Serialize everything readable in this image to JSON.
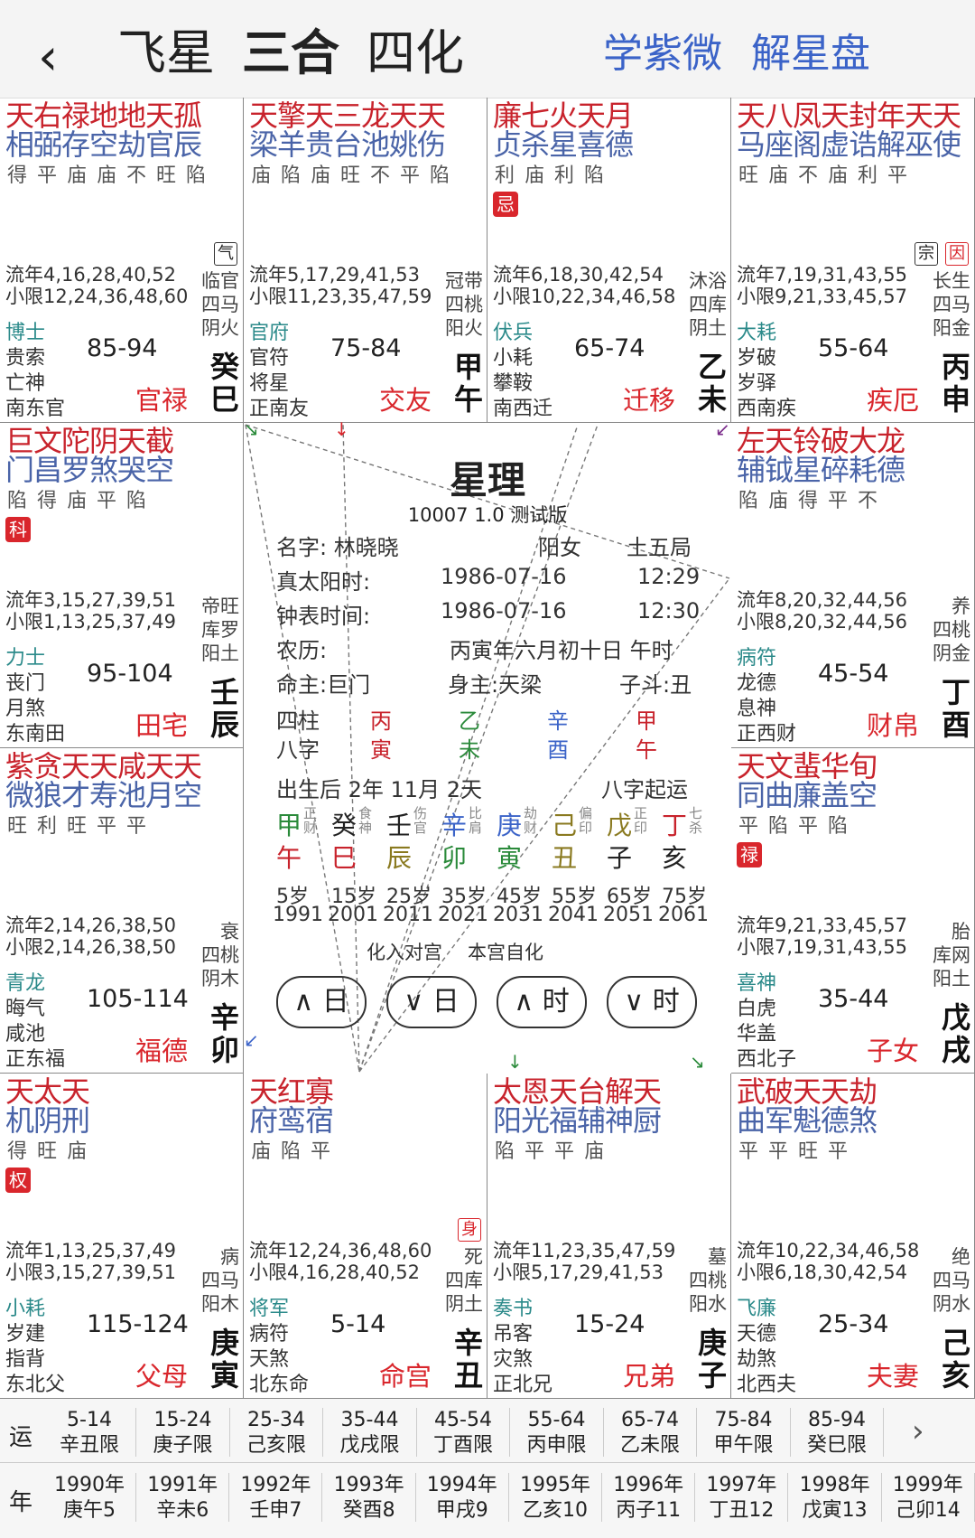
{
  "header": {
    "back": "‹",
    "tabs": [
      "飞星",
      "三合",
      "四化"
    ],
    "links": [
      "学紫微",
      "解星盘"
    ]
  },
  "cells": [
    {
      "stars": [
        {
          "t": "天右禄地地天孤",
          "c": "#c8232c"
        },
        {
          "t": "相弼存空劫官辰",
          "c": "#4a64a8"
        }
      ],
      "bright": "得 平 庙 庙 不 旺 陷",
      "hua": "",
      "tags": [
        {
          "t": "气",
          "red": false
        }
      ],
      "liunian": "流年4,16,28,40,52",
      "xiaoxian": "小限12,24,36,48,60",
      "boshi": "博士",
      "s2": "贵索",
      "s3": "亡神",
      "s4": "南东官",
      "range": "85-94",
      "pname": "官禄",
      "r1": "临官",
      "r2": "四马",
      "r3": "阴火",
      "g1": "癸",
      "g2": "巳"
    },
    {
      "stars": [
        {
          "t": "天擎天三龙天天",
          "c": "#c8232c"
        },
        {
          "t": "梁羊贵台池姚伤",
          "c": "#4a64a8"
        }
      ],
      "bright": "庙 陷 庙 旺 不 平 陷",
      "hua": "",
      "tags": [],
      "liunian": "流年5,17,29,41,53",
      "xiaoxian": "小限11,23,35,47,59",
      "boshi": "官府",
      "s2": "官符",
      "s3": "将星",
      "s4": "正南友",
      "range": "75-84",
      "pname": "交友",
      "r1": "冠带",
      "r2": "四桃",
      "r3": "阳火",
      "g1": "甲",
      "g2": "午"
    },
    {
      "stars": [
        {
          "t": "廉七火天月",
          "c": "#c8232c"
        },
        {
          "t": "贞杀星喜德",
          "c": "#4a64a8"
        }
      ],
      "bright": "利 庙 利 陷",
      "hua": "忌",
      "tags": [],
      "liunian": "流年6,18,30,42,54",
      "xiaoxian": "小限10,22,34,46,58",
      "boshi": "伏兵",
      "s2": "小耗",
      "s3": "攀鞍",
      "s4": "南西迁",
      "range": "65-74",
      "pname": "迁移",
      "r1": "沐浴",
      "r2": "四库",
      "r3": "阴土",
      "g1": "乙",
      "g2": "未"
    },
    {
      "stars": [
        {
          "t": "天八凤天封年天天",
          "c": "#c8232c"
        },
        {
          "t": "马座阁虚诰解巫使",
          "c": "#4a64a8"
        }
      ],
      "bright": "旺 庙 不 庙   利    平",
      "hua": "",
      "tags": [
        {
          "t": "宗",
          "red": false
        },
        {
          "t": "因",
          "red": true
        }
      ],
      "liunian": "流年7,19,31,43,55",
      "xiaoxian": "小限9,21,33,45,57",
      "boshi": "大耗",
      "s2": "岁破",
      "s3": "岁驿",
      "s4": "西南疾",
      "range": "55-64",
      "pname": "疾厄",
      "r1": "长生",
      "r2": "四马",
      "r3": "阳金",
      "g1": "丙",
      "g2": "申"
    },
    {
      "stars": [
        {
          "t": "巨文陀阴天截",
          "c": "#c8232c"
        },
        {
          "t": "门昌罗煞哭空",
          "c": "#4a64a8"
        }
      ],
      "bright": "陷 得 庙    平 陷",
      "hua": "科",
      "tags": [],
      "liunian": "流年3,15,27,39,51",
      "xiaoxian": "小限1,13,25,37,49",
      "boshi": "力士",
      "s2": "丧门",
      "s3": "月煞",
      "s4": "东南田",
      "range": "95-104",
      "pname": "田宅",
      "r1": "帝旺",
      "r2": "库罗",
      "r3": "阳土",
      "g1": "壬",
      "g2": "辰"
    },
    {
      "stars": [
        {
          "t": "左天铃破大龙",
          "c": "#c8232c"
        },
        {
          "t": "辅钺星碎耗德",
          "c": "#4a64a8"
        }
      ],
      "bright": "陷 庙 得 平 不",
      "hua": "",
      "tags": [],
      "liunian": "流年8,20,32,44,56",
      "xiaoxian": "小限8,20,32,44,56",
      "boshi": "病符",
      "s2": "龙德",
      "s3": "息神",
      "s4": "正西财",
      "range": "45-54",
      "pname": "财帛",
      "r1": "养",
      "r2": "四桃",
      "r3": "阴金",
      "g1": "丁",
      "g2": "酉"
    },
    {
      "stars": [
        {
          "t": "紫贪天天咸天天",
          "c": "#c8232c"
        },
        {
          "t": "微狼才寿池月空",
          "c": "#4a64a8"
        }
      ],
      "bright": "旺 利 旺    平    平",
      "hua": "",
      "tags": [],
      "liunian": "流年2,14,26,38,50",
      "xiaoxian": "小限2,14,26,38,50",
      "boshi": "青龙",
      "s2": "晦气",
      "s3": "咸池",
      "s4": "正东福",
      "range": "105-114",
      "pname": "福德",
      "r1": "衰",
      "r2": "四桃",
      "r3": "阴木",
      "g1": "辛",
      "g2": "卯"
    },
    {
      "stars": [
        {
          "t": "天文蜚华旬",
          "c": "#c8232c"
        },
        {
          "t": "同曲廉盖空",
          "c": "#4a64a8"
        }
      ],
      "bright": "平 陷    平 陷",
      "hua": "禄",
      "tags": [],
      "liunian": "流年9,21,33,45,57",
      "xiaoxian": "小限7,19,31,43,55",
      "boshi": "喜神",
      "s2": "白虎",
      "s3": "华盖",
      "s4": "西北子",
      "range": "35-44",
      "pname": "子女",
      "r1": "胎",
      "r2": "库网",
      "r3": "阳土",
      "g1": "戊",
      "g2": "戌"
    },
    {
      "stars": [
        {
          "t": "天太天",
          "c": "#c8232c"
        },
        {
          "t": "机阴刑",
          "c": "#4a64a8"
        }
      ],
      "bright": "得 旺 庙",
      "hua": "权",
      "tags": [],
      "liunian": "流年1,13,25,37,49",
      "xiaoxian": "小限3,15,27,39,51",
      "boshi": "小耗",
      "s2": "岁建",
      "s3": "指背",
      "s4": "东北父",
      "range": "115-124",
      "pname": "父母",
      "r1": "病",
      "r2": "四马",
      "r3": "阳木",
      "g1": "庚",
      "g2": "寅"
    },
    {
      "stars": [
        {
          "t": "天红寡",
          "c": "#c8232c"
        },
        {
          "t": "府鸾宿",
          "c": "#4a64a8"
        }
      ],
      "bright": "庙 陷 平",
      "hua": "",
      "tags": [
        {
          "t": "身",
          "red": true
        }
      ],
      "liunian": "流年12,24,36,48,60",
      "xiaoxian": "小限4,16,28,40,52",
      "boshi": "将军",
      "s2": "病符",
      "s3": "天煞",
      "s4": "北东命",
      "range": "5-14",
      "pname": "命宫",
      "r1": "死",
      "r2": "四库",
      "r3": "阴土",
      "g1": "辛",
      "g2": "丑"
    },
    {
      "stars": [
        {
          "t": "太恩天台解天",
          "c": "#c8232c"
        },
        {
          "t": "阳光福辅神厨",
          "c": "#4a64a8"
        }
      ],
      "bright": "陷 平 平    庙",
      "hua": "",
      "tags": [],
      "liunian": "流年11,23,35,47,59",
      "xiaoxian": "小限5,17,29,41,53",
      "boshi": "奏书",
      "s2": "吊客",
      "s3": "灾煞",
      "s4": "正北兄",
      "range": "15-24",
      "pname": "兄弟",
      "r1": "墓",
      "r2": "四桃",
      "r3": "阳水",
      "g1": "庚",
      "g2": "子"
    },
    {
      "stars": [
        {
          "t": "武破天天劫",
          "c": "#c8232c"
        },
        {
          "t": "曲军魁德煞",
          "c": "#4a64a8"
        }
      ],
      "bright": "平 平 旺 平",
      "hua": "",
      "tags": [],
      "liunian": "流年10,22,34,46,58",
      "xiaoxian": "小限6,18,30,42,54",
      "boshi": "飞廉",
      "s2": "天德",
      "s3": "劫煞",
      "s4": "北西夫",
      "range": "25-34",
      "pname": "夫妻",
      "r1": "绝",
      "r2": "四马",
      "r3": "阴水",
      "g1": "己",
      "g2": "亥"
    }
  ],
  "center": {
    "title": "星理",
    "subtitle": "10007 1.0 测试版",
    "name_label": "名字: 林晓晓",
    "gender": "阳女",
    "ju": "土五局",
    "solar_label": "真太阳时:",
    "solar_date": "1986-07-16",
    "solar_time": "12:29",
    "clock_label": "钟表时间:",
    "clock_date": "1986-07-16",
    "clock_time": "12:30",
    "lunar_label": "农历:",
    "lunar": "丙寅年六月初十日 午时",
    "ming": "命主:巨门",
    "shen": "身主:天梁",
    "dou": "子斗:丑",
    "sizhu_label": "四柱",
    "bazi_label": "八字",
    "pillars": [
      {
        "top": "丙",
        "bot": "寅",
        "c": "#c8232c"
      },
      {
        "top": "乙",
        "bot": "未",
        "c": "#2a8a3a"
      },
      {
        "top": "辛",
        "bot": "酉",
        "c": "#3b63c8"
      },
      {
        "top": "甲",
        "bot": "午",
        "c": "#c8232c"
      }
    ],
    "birth_after": "出生后 2年 11月 2天",
    "bazi_qiyun": "八字起运",
    "dayun": [
      {
        "g": "甲",
        "gc": "#2a8a3a",
        "z": "午",
        "zc": "#c8232c",
        "s": "正财"
      },
      {
        "g": "癸",
        "gc": "#222",
        "z": "巳",
        "zc": "#c8232c",
        "s": "食神"
      },
      {
        "g": "壬",
        "gc": "#222",
        "z": "辰",
        "zc": "#8a7a20",
        "s": "伤官"
      },
      {
        "g": "辛",
        "gc": "#3b63c8",
        "z": "卯",
        "zc": "#2a8a3a",
        "s": "比肩"
      },
      {
        "g": "庚",
        "gc": "#3b63c8",
        "z": "寅",
        "zc": "#2a8a3a",
        "s": "劫财"
      },
      {
        "g": "己",
        "gc": "#8a7a20",
        "z": "丑",
        "zc": "#8a7a20",
        "s": "偏印"
      },
      {
        "g": "戊",
        "gc": "#8a7a20",
        "z": "子",
        "zc": "#222",
        "s": "正印"
      },
      {
        "g": "丁",
        "gc": "#c8232c",
        "z": "亥",
        "zc": "#222",
        "s": "七杀"
      }
    ],
    "ages": [
      "5岁",
      "15岁",
      "25岁",
      "35岁",
      "45岁",
      "55岁",
      "65岁",
      "75岁"
    ],
    "years": [
      "1991",
      "2001",
      "2011",
      "2021",
      "2031",
      "2041",
      "2051",
      "2061"
    ],
    "huaru": "化入对宫",
    "zihua": "本宫自化",
    "buttons": [
      "日",
      "日",
      "时",
      "时"
    ]
  },
  "bottom": {
    "yun_label": "运",
    "nian_label": "年",
    "more": "›",
    "yun": [
      [
        "5-14",
        "辛丑限"
      ],
      [
        "15-24",
        "庚子限"
      ],
      [
        "25-34",
        "己亥限"
      ],
      [
        "35-44",
        "戊戌限"
      ],
      [
        "45-54",
        "丁酉限"
      ],
      [
        "55-64",
        "丙申限"
      ],
      [
        "65-74",
        "乙未限"
      ],
      [
        "75-84",
        "甲午限"
      ],
      [
        "85-94",
        "癸巳限"
      ]
    ],
    "nian": [
      [
        "1990年",
        "庚午5"
      ],
      [
        "1991年",
        "辛未6"
      ],
      [
        "1992年",
        "壬申7"
      ],
      [
        "1993年",
        "癸酉8"
      ],
      [
        "1994年",
        "甲戌9"
      ],
      [
        "1995年",
        "乙亥10"
      ],
      [
        "1996年",
        "丙子11"
      ],
      [
        "1997年",
        "丁丑12"
      ],
      [
        "1998年",
        "戊寅13"
      ],
      [
        "1999年",
        "己卯14"
      ]
    ]
  }
}
